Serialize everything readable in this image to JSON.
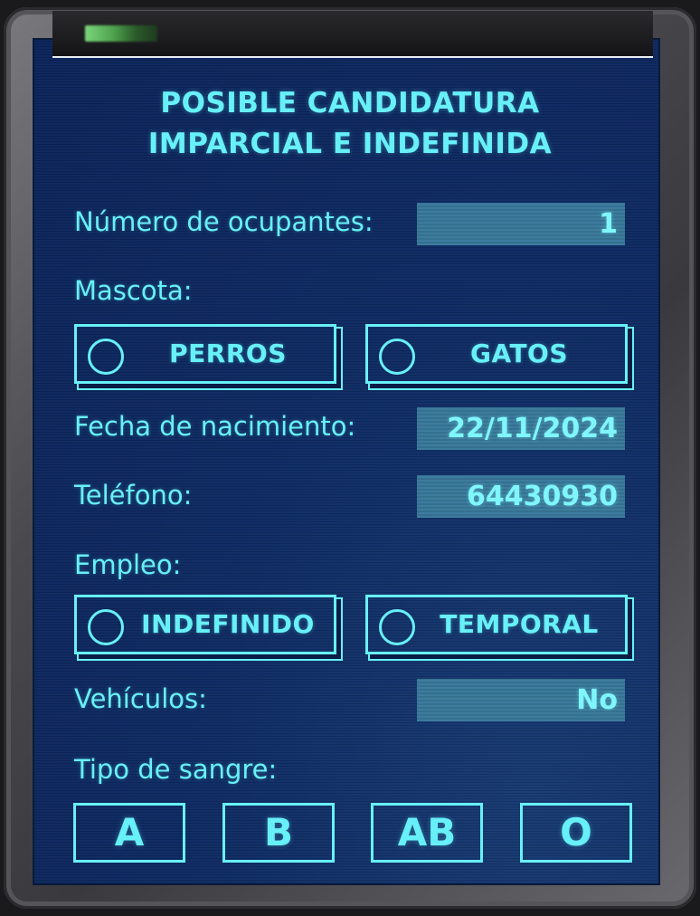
{
  "form": {
    "title_line1": "POSIBLE CANDIDATURA",
    "title_line2": "IMPARCIAL E INDEFINIDA"
  },
  "fields": {
    "ocupantes": {
      "label": "Número de ocupantes:",
      "value": "1"
    },
    "mascota": {
      "label": "Mascota:",
      "options": [
        "PERROS",
        "GATOS"
      ]
    },
    "nacimiento": {
      "label": "Fecha de nacimiento:",
      "value": "22/11/2024"
    },
    "telefono": {
      "label": "Teléfono:",
      "value": "64430930"
    },
    "empleo": {
      "label": "Empleo:",
      "options": [
        "INDEFINIDO",
        "TEMPORAL"
      ]
    },
    "vehiculos": {
      "label": "Vehículos:",
      "value": "No"
    },
    "sangre": {
      "label": "Tipo de sangre:",
      "options": [
        "A",
        "B",
        "AB",
        "O"
      ]
    }
  },
  "colors": {
    "accent": "#67f0f7",
    "screen_bg": "#0e2b63",
    "field_bg": "#3d7c9e",
    "frame": "#4a4a4e"
  },
  "icons": {
    "radio": "radio-circle-icon",
    "led": "status-led-icon"
  }
}
